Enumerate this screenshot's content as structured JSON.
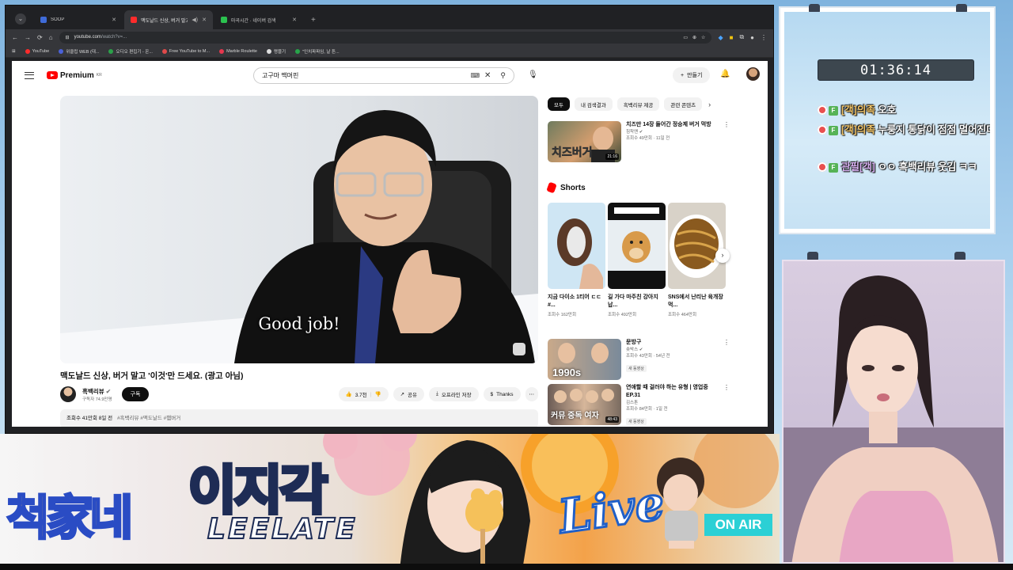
{
  "browser": {
    "tabs": [
      {
        "title": "SOOP",
        "color": "#3f6bd8",
        "active": false
      },
      {
        "title": "맥도날드 신상, 버거 말고",
        "color": "#ff2b2b",
        "active": true
      },
      {
        "title": "마곡시간 · 네이버 검색",
        "color": "#2bc24f",
        "active": false
      }
    ],
    "new_tab": "+",
    "url": "youtube.com",
    "url_rest": "/watch?v=...",
    "bookmarks": [
      {
        "label": "YouTube",
        "color": "#ff2b2b"
      },
      {
        "label": "위클립 WEB (대...",
        "color": "#4a61d8"
      },
      {
        "label": "오디오 편집기 - 온...",
        "color": "#2ba14a"
      },
      {
        "label": "Free YouTube to M...",
        "color": "#e04a4a"
      },
      {
        "label": "Marble Roulette",
        "color": "#e6374e"
      },
      {
        "label": "랭블기",
        "color": "#dddddd"
      },
      {
        "label": "\"인치파파임, 날 튼...",
        "color": "#27a44a"
      }
    ]
  },
  "youtube": {
    "logo": "Premium",
    "logo_sup": "KR",
    "search_value": "고구마 맥머핀",
    "create_label": "만들기",
    "subtitle": "Good job!",
    "video_title": "맥도날드 신상, 버거 말고 '이것'만 드세요. (광고 아님)",
    "channel_name": "흑백리뷰",
    "channel_subs": "구독자 74.9만명",
    "subscribe_label": "구독",
    "like_count": "3.7천",
    "share_label": "공유",
    "offline_label": "오프라인 저장",
    "thanks_label": "Thanks",
    "desc_views": "조회수 41만회  8일 전",
    "desc_tags": "#흑백리뷰 #맥도날드 #햄버거",
    "chips": [
      "모두",
      "내 검색결과",
      "흑백리뷰 제공",
      "관련 콘텐츠"
    ],
    "rec_top": {
      "title": "치즈만 14장 들어간 정승제 버거 먹방",
      "channel": "침착맨",
      "meta": "조회수 49만회 · 11일 전",
      "duration": "21:16"
    },
    "shorts_label": "Shorts",
    "shorts": [
      {
        "title": "지금 다이소 1티어 ㄷㄷ #...",
        "views": "조회수 162만회",
        "bg": "#cfe6f4"
      },
      {
        "title": "길 가다 마주친 강아지 납...",
        "views": "조회수 492만회",
        "bg": "#e8eef2"
      },
      {
        "title": "SNS에서 난리난 육개장 먹...",
        "views": "조회수 464만회",
        "bg": "#9a6a2a"
      }
    ],
    "recs": [
      {
        "title": "문방구",
        "channel": "숏박스",
        "meta": "조회수 43만회 · 54년 전",
        "badge": "새 동영상",
        "duration": "",
        "overlay": "1990s"
      },
      {
        "title": "연애할 때 걸러야 하는 유형 | 영업중EP.31",
        "channel": "김스톤",
        "meta": "조회수 84만회 · 1일 전",
        "badge": "새 동영상",
        "duration": "48:43",
        "overlay": "커뮤 중독 여자"
      }
    ]
  },
  "chat": {
    "timer": "01:36:14",
    "messages": [
      {
        "nick": "[객]의족",
        "text": "오호",
        "nick_class": "nick"
      },
      {
        "nick": "[객]의족",
        "text": "누룽지 통닭이 점점 멀어진다",
        "nick_class": "nick"
      },
      {
        "nick": "관필[객]",
        "text": "ㅇㅇ 흑백리뷰 웃김 ㅋㅋ",
        "nick_class": "nick2"
      }
    ],
    "badge_f": "F"
  },
  "banner": {
    "brand": "척家네",
    "name_ko": "이지각",
    "name_en": "LEELATE",
    "live": "Live",
    "onair": "ON AIR"
  },
  "colors": {
    "youtube_red": "#ff0000",
    "onair_cyan": "#2bd0d5",
    "chat_bg": "#cfe7f7"
  }
}
